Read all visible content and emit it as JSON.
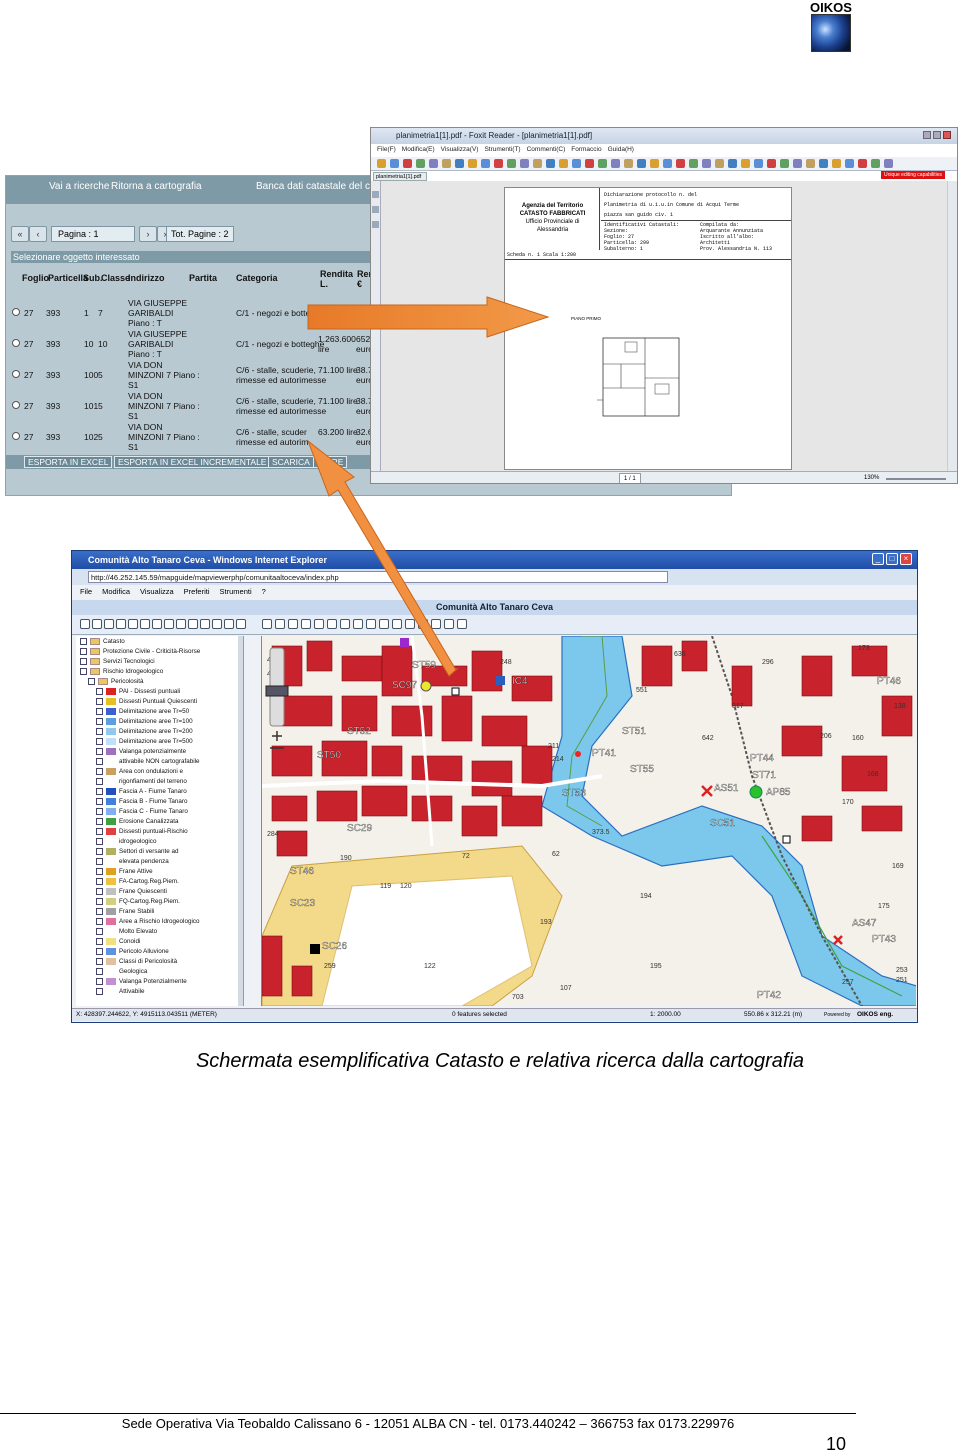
{
  "logo": {
    "text": "OIKOS"
  },
  "catasto": {
    "nav_left": "Vai a ricerche",
    "nav_mid": "Ritorna a cartografia",
    "nav_right": "Banca dati catastale del com",
    "pagina_label": "Pagina : 1",
    "tot_pagine": "Tot. Pagine : 2",
    "select_hint": "Selezionare oggetto interessato",
    "headers": {
      "foglio": "Foglio",
      "particella": "Particella",
      "sub": "Sub.",
      "classe": "Classe",
      "indirizzo": "Indirizzo",
      "partita": "Partita",
      "categoria": "Categoria",
      "rendita": "Rendita",
      "rendita2": "L.",
      "ren": "Ren",
      "euro": "€"
    },
    "rows": [
      {
        "foglio": "27",
        "particella": "393",
        "sub": "1",
        "classe": "7",
        "indirizzo": [
          "VIA GIUSEPPE",
          "GARIBALDI",
          "Piano : T"
        ],
        "categoria": "C/1 - negozi e botteghe",
        "rendita": "",
        "ren": ""
      },
      {
        "foglio": "27",
        "particella": "393",
        "sub": "10",
        "classe": "10",
        "indirizzo": [
          "VIA GIUSEPPE",
          "GARIBALDI",
          "Piano : T"
        ],
        "categoria": "C/1 - negozi e botteghe",
        "rendita": [
          "1.263.600",
          "lire"
        ],
        "ren": [
          "652.",
          "euro"
        ]
      },
      {
        "foglio": "27",
        "particella": "393",
        "sub": "100",
        "classe": "5",
        "indirizzo": [
          "VIA DON",
          "MINZONI 7 Piano :",
          "S1"
        ],
        "categoria": [
          "C/6 - stalle, scuderie,",
          "rimesse ed autorimesse"
        ],
        "rendita": [
          "71.100 lire"
        ],
        "ren": [
          "38.7",
          "euro"
        ]
      },
      {
        "foglio": "27",
        "particella": "393",
        "sub": "101",
        "classe": "5",
        "indirizzo": [
          "VIA DON",
          "MINZONI 7 Piano :",
          "S1"
        ],
        "categoria": [
          "C/6 - stalle, scuderie,",
          "rimesse ed autorimesse"
        ],
        "rendita": [
          "71.100 lire"
        ],
        "ren": [
          "38.7",
          "euro"
        ]
      },
      {
        "foglio": "27",
        "particella": "393",
        "sub": "102",
        "classe": "5",
        "indirizzo": [
          "VIA DON",
          "MINZONI 7 Piano :",
          "S1"
        ],
        "categoria": [
          "C/6 - stalle, scuder",
          "rimesse ed autorim"
        ],
        "rendita": [
          "63.200 lire"
        ],
        "ren": [
          "32.6",
          "euro"
        ]
      }
    ],
    "buttons": {
      "excel": "ESPORTA IN EXCEL",
      "excel_incr": "ESPORTA IN EXCEL INCREMENTALE",
      "scarica": "SCARICA",
      "incre": "INCRE"
    }
  },
  "pdf": {
    "title": "planimetria1[1].pdf - Foxit Reader - [planimetria1[1].pdf]",
    "menu": [
      "File(F)",
      "Modifica(E)",
      "Visualizza(V)",
      "Strumenti(T)",
      "Commenti(C)",
      "Formaccio",
      "Guida(H)"
    ],
    "tab": "planimetria1[1].pdf",
    "unique_label": "Unique editing capabilities",
    "agency": [
      "Agenzia del Territorio",
      "CATASTO FABBRICATI",
      "Ufficio Provinciale di",
      "Alessandria"
    ],
    "sheet_lines": [
      "Dichiarazione protocollo n.        del",
      "Planimetria di u.i.u.in Comune di Acqui Terme",
      "piazza san guido                    civ. 1"
    ],
    "ident": [
      "Identificativi Catastali:",
      "  Sezione:",
      "  Foglio: 27",
      "  Particella: 299",
      "  Subalterno: 1"
    ],
    "compilata": [
      "Compilata da:",
      "Arquarante Annunziata",
      "Iscritto all'albo:",
      "Architetti",
      "Prov. Alessandria    N. 113"
    ],
    "scheda": "Scheda n. 1     Scala 1:200",
    "piano": "PIANO PRIMO",
    "page_indicator": "1 / 1",
    "zoom": "130%"
  },
  "ie": {
    "title": "Comunità Alto Tanaro Ceva - Windows Internet Explorer",
    "url": "http://46.252.145.59/mapguide/mapviewerphp/comunitaaltoceva/index.php",
    "menu": [
      "File",
      "Modifica",
      "Visualizza",
      "Preferiti",
      "Strumenti",
      "?"
    ],
    "site_title": "Comunità Alto Tanaro Ceva",
    "legend": [
      {
        "label": "Catasto",
        "level": 0,
        "swatch": ""
      },
      {
        "label": "Protezione Civile - Criticità-Risorse",
        "level": 0,
        "swatch": ""
      },
      {
        "label": "Servizi Tecnologici",
        "level": 0,
        "swatch": ""
      },
      {
        "label": "Rischio Idrogeologico",
        "level": 0,
        "swatch": ""
      },
      {
        "label": "Pericolosità",
        "level": 1,
        "swatch": ""
      },
      {
        "label": "PAI - Dissesti puntuali",
        "level": 2,
        "swatch": "#d22"
      },
      {
        "label": "Dissesti Puntuali Quiescenti",
        "level": 2,
        "swatch": "#e6c020"
      },
      {
        "label": "Delimitazione aree Tr=50",
        "level": 2,
        "swatch": "#3a5fd0"
      },
      {
        "label": "Delimitazione aree Tr=100",
        "level": 2,
        "swatch": "#5aa0e0"
      },
      {
        "label": "Delimitazione aree Tr=200",
        "level": 2,
        "swatch": "#90c8f0"
      },
      {
        "label": "Delimitazione aree Tr=500",
        "level": 2,
        "swatch": "#c0e0f8"
      },
      {
        "label": "Valanga potenzialmente",
        "level": 2,
        "swatch": "#a070c0"
      },
      {
        "label": "attivabile NON cartografabile",
        "level": 2,
        "swatch": ""
      },
      {
        "label": "Area con ondulazioni e",
        "level": 2,
        "swatch": "#c8a060"
      },
      {
        "label": "rigonfiamenti del terreno",
        "level": 2,
        "swatch": ""
      },
      {
        "label": "Fascia A - Fiume Tanaro",
        "level": 2,
        "swatch": "#2050c0"
      },
      {
        "label": "Fascia B - Fiume Tanaro",
        "level": 2,
        "swatch": "#4080e0"
      },
      {
        "label": "Fascia C - Fiume Tanaro",
        "level": 2,
        "swatch": "#80b0f0"
      },
      {
        "label": "Erosione Canalizzata",
        "level": 2,
        "swatch": "#40a040"
      },
      {
        "label": "Dissesti puntuali-Rischio",
        "level": 2,
        "swatch": "#e04040"
      },
      {
        "label": "idrogeologico",
        "level": 2,
        "swatch": ""
      },
      {
        "label": "Settori di versante ad",
        "level": 2,
        "swatch": "#b0b060"
      },
      {
        "label": "elevata pendenza",
        "level": 2,
        "swatch": ""
      },
      {
        "label": "Frane Attive",
        "level": 2,
        "swatch": "#e0a020"
      },
      {
        "label": "FA-Cartog.Reg.Piem.",
        "level": 2,
        "swatch": "#f0c040"
      },
      {
        "label": "Frane Quiescenti",
        "level": 2,
        "swatch": "#c0c0c0"
      },
      {
        "label": "FQ-Cartog.Reg.Piem.",
        "level": 2,
        "swatch": "#d0d080"
      },
      {
        "label": "Frane Stabili",
        "level": 2,
        "swatch": "#a0a0a0"
      },
      {
        "label": "Aree a Rischio Idrogeologico",
        "level": 2,
        "swatch": "#e070a0"
      },
      {
        "label": "Molto Elevato",
        "level": 2,
        "swatch": ""
      },
      {
        "label": "Conoidi",
        "level": 2,
        "swatch": "#f0e080"
      },
      {
        "label": "Pericolo Alluvione",
        "level": 2,
        "swatch": "#6090e0"
      },
      {
        "label": "Classi di Pericolosità",
        "level": 2,
        "swatch": "#e0c0a0"
      },
      {
        "label": "Geologica",
        "level": 2,
        "swatch": ""
      },
      {
        "label": "Valanga Potenzialmente",
        "level": 2,
        "swatch": "#c090d0"
      },
      {
        "label": "Attivabile",
        "level": 2,
        "swatch": ""
      }
    ],
    "map_labels": [
      "ST59",
      "SC97",
      "ST52",
      "ST50",
      "SC29",
      "ST46",
      "SC23",
      "SC26",
      "ST53",
      "ST51",
      "ST55",
      "PT41",
      "PT44",
      "ST71",
      "AP85",
      "AS51",
      "SC51",
      "AS47",
      "PT43",
      "PT42",
      "PT46",
      "IC4"
    ],
    "map_numbers": [
      "173",
      "636",
      "296",
      "446",
      "448",
      "248",
      "317",
      "206",
      "642",
      "160",
      "168",
      "170",
      "373.5",
      "62",
      "72",
      "119",
      "120",
      "190",
      "194",
      "193",
      "195",
      "122",
      "259",
      "107",
      "703",
      "257",
      "175",
      "138",
      "169",
      "253",
      "251",
      "551",
      "211",
      "214",
      "284"
    ],
    "status_coords": "X: 428397.244622, Y: 4915113.043511 (METER)",
    "status_features": "0 features selected",
    "status_scale": "1: 2000.00",
    "status_size": "550.86 x 312.21 (m)",
    "powered": "Powered by",
    "powered_brand": "OIKOS eng."
  },
  "caption": "Schermata esemplificativa Catasto e relativa ricerca dalla cartografia",
  "footer": "Sede Operativa Via Teobaldo Calissano 6  - 12051 ALBA CN - tel. 0173.440242 – 366753  fax 0173.229976",
  "page_number": "10"
}
